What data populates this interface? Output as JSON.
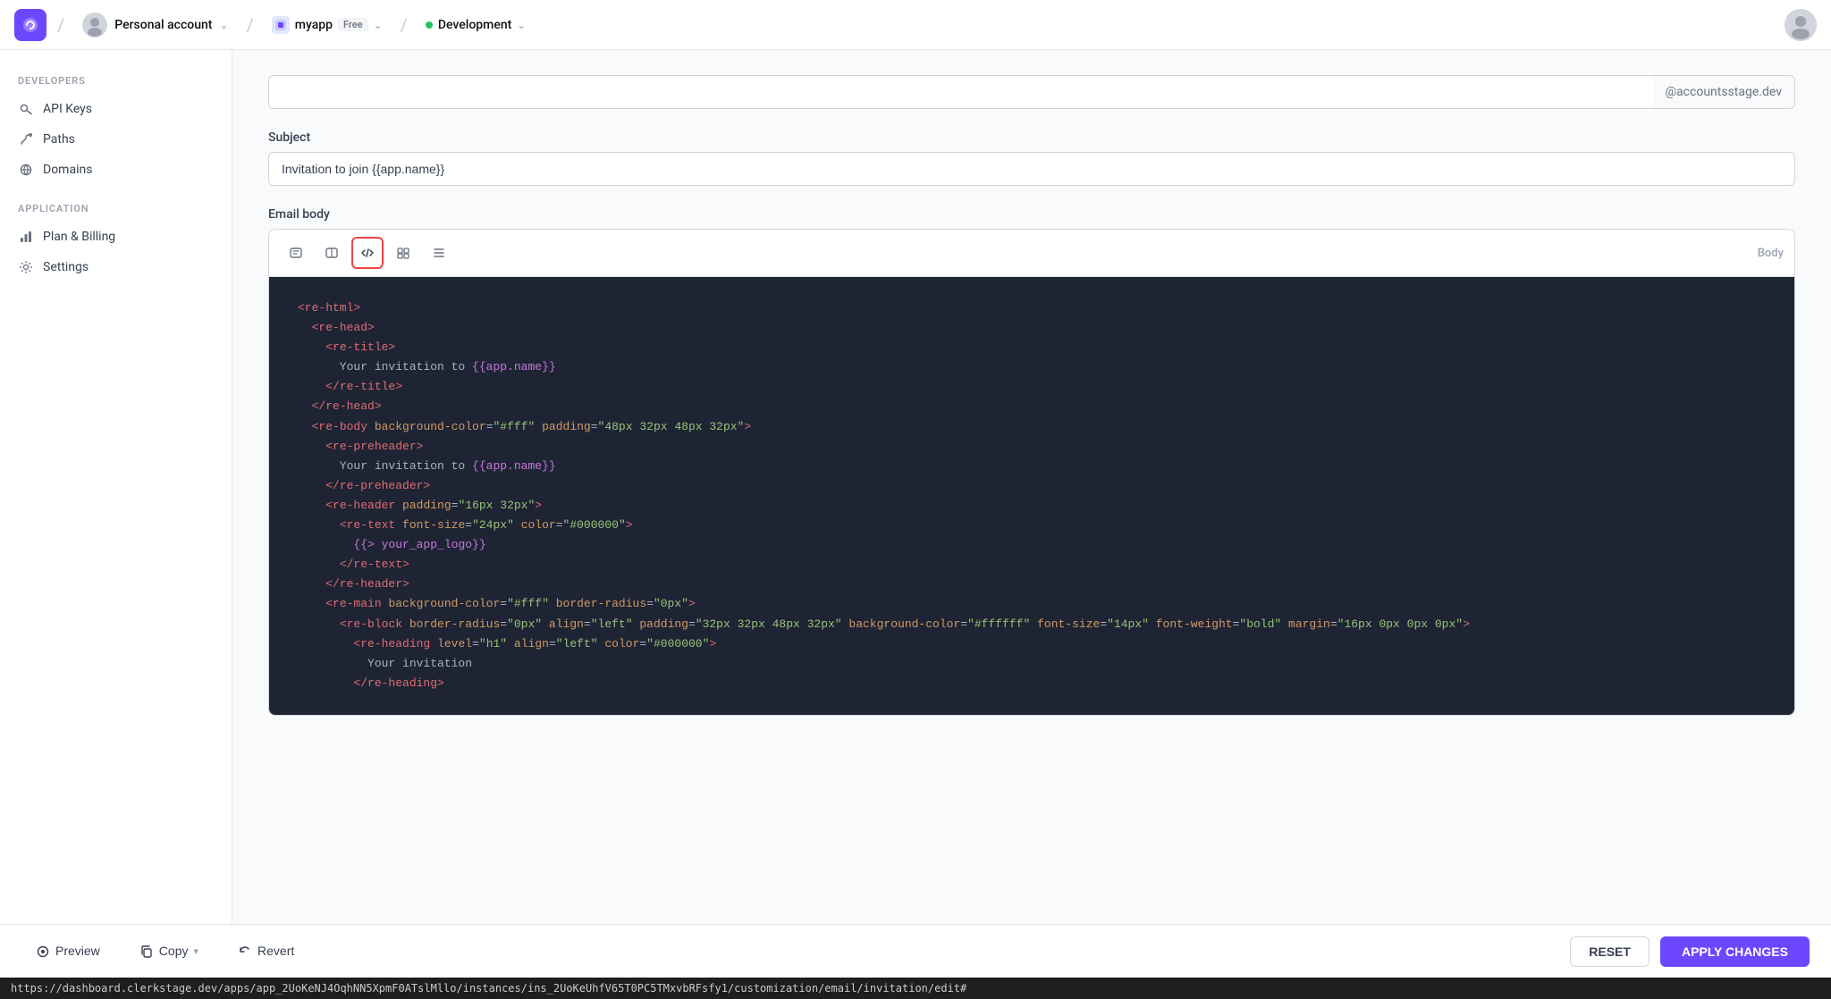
{
  "topbar": {
    "logo_letter": "C",
    "account_name": "Personal account",
    "app_name": "myapp",
    "app_badge": "Free",
    "env_name": "Development",
    "env_color": "#22c55e"
  },
  "sidebar": {
    "developers_label": "DEVELOPERS",
    "application_label": "APPLICATION",
    "items_developers": [
      {
        "id": "api-keys",
        "label": "API Keys",
        "icon": "key"
      },
      {
        "id": "paths",
        "label": "Paths",
        "icon": "path",
        "active": false
      },
      {
        "id": "domains",
        "label": "Domains",
        "icon": "globe"
      }
    ],
    "items_application": [
      {
        "id": "plan-billing",
        "label": "Plan & Billing",
        "icon": "bar-chart"
      },
      {
        "id": "settings",
        "label": "Settings",
        "icon": "gear"
      }
    ]
  },
  "content": {
    "email_suffix": "@accountsstage.dev",
    "subject_label": "Subject",
    "subject_value": "Invitation to join {{app.name}}",
    "email_body_label": "Email body",
    "toolbar_label": "Body",
    "code_content": "<re-html>\n  <re-head>\n    <re-title>\n      Your invitation to {{app.name}}\n    </re-title>\n  </re-head>\n  <re-body background-color=\"#fff\" padding=\"48px 32px 48px 32px\">\n    <re-preheader>\n      Your invitation to {{app.name}}\n    </re-preheader>\n    <re-header padding=\"16px 32px\">\n      <re-text font-size=\"24px\" color=\"#000000\">\n        {{> your_app_logo}}\n      </re-text>\n    </re-header>\n    <re-main background-color=\"#fff\" border-radius=\"0px\">\n      <re-block border-radius=\"0px\" align=\"left\" padding=\"32px 32px 48px 32px\" background-color=\"#ffffff\" font-size=\"14px\" font-weight=\"bold\" margin=\"16px 0px 0px 0px\">\n        <re-heading level=\"h1\" align=\"left\" color=\"#000000\">\n          Your invitation\n        </re-heading>"
  },
  "bottom_bar": {
    "preview_label": "Preview",
    "copy_label": "Copy",
    "revert_label": "Revert",
    "reset_label": "RESET",
    "apply_label": "APPLY CHANGES"
  },
  "status_bar": {
    "url": "https://dashboard.clerkstage.dev/apps/app_2UoKeNJ4OqhNN5XpmF0ATslMllo/instances/ins_2UoKeUhfV65T0PC5TMxvbRFsfy1/customization/email/invitation/edit#"
  }
}
